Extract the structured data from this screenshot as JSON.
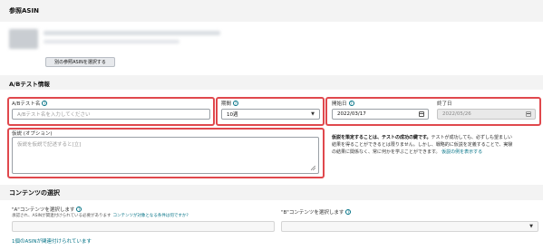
{
  "reference_asin": {
    "title": "参照ASIN",
    "select_button": "別の参照ASINを選択する"
  },
  "ab_test": {
    "title": "A/Bテスト情報",
    "name_label": "A/Bテスト名",
    "name_placeholder": "A/Bテスト名を入力してください",
    "period_label": "期間",
    "period_value": "10週",
    "start_label": "開始日",
    "start_value": "2022/03/17",
    "end_label": "終了日",
    "end_value": "2022/05/26",
    "hypothesis_label": "仮説 (オプション)",
    "hypothesis_placeholder": "仮説を仮説で記述すると[立]",
    "desc_bold": "仮説を策定することは、テストの成功の鍵です。",
    "desc_line1_rest": "テストが成功しても、必ずしも望ましい",
    "desc_line2": "結果を得ることができるとは限りません。しかし、戦略的に仮説を定義することで、実験",
    "desc_line3": "の結果に関係なく、常に何かを学ぶことができます。",
    "desc_link": "仮説の例を表示する"
  },
  "content_selection": {
    "title": "コンテンツの選択",
    "a_label": "\"A\"コンテンツを選択します",
    "b_label": "\"B\"コンテンツを選択します",
    "a_note": "承認され、ASINが関連付けられている必要があります",
    "a_note_link": "コンテンツが対象となる条件は何ですか?",
    "footer_link": "1個のASINが関連付けられています"
  },
  "icons": {
    "info": "info-icon",
    "dropdown": "chevron-down-icon",
    "calendar": "calendar-icon",
    "resize": "resize-handle-icon"
  },
  "colors": {
    "highlight": "#e0484d",
    "link": "#007185",
    "band": "#f3f3f3"
  }
}
